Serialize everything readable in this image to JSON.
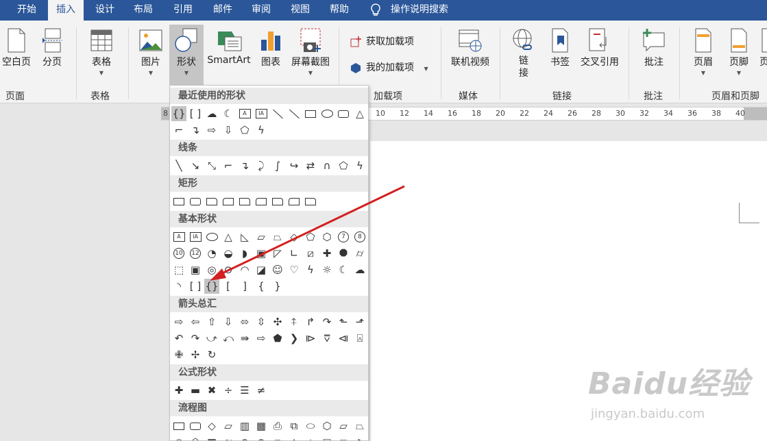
{
  "tabs": {
    "t1": "开始",
    "t2": "插入",
    "t3": "设计",
    "t4": "布局",
    "t5": "引用",
    "t6": "邮件",
    "t7": "审阅",
    "t8": "视图",
    "t9": "帮助",
    "search": "操作说明搜索"
  },
  "ribbon": {
    "blank_page": "空白页",
    "page_break": "分页",
    "table": "表格",
    "pictures": "图片",
    "shapes": "形状",
    "smartart": "SmartArt",
    "chart": "图表",
    "screenshot": "屏幕截图",
    "get_addins": "获取加载项",
    "my_addins": "我的加载项",
    "online_video": "联机视频",
    "link": "链\n接",
    "bookmark": "书签",
    "cross_ref": "交叉引用",
    "comment": "批注",
    "header": "页眉",
    "footer": "页脚",
    "page_num_partial": "页"
  },
  "groups": {
    "pages": "页面",
    "tables": "表格",
    "addins": "加载项",
    "media": "媒体",
    "links": "链接",
    "comments": "批注",
    "header_footer": "页眉和页脚"
  },
  "ruler": [
    "8",
    "10",
    "12",
    "14",
    "16",
    "18",
    "20",
    "22",
    "24",
    "26",
    "28",
    "30",
    "32",
    "34",
    "36",
    "38",
    "40"
  ],
  "gallery": {
    "recent": "最近使用的形状",
    "lines": "线条",
    "rectangles": "矩形",
    "basic": "基本形状",
    "block_arrows": "箭头总汇",
    "equation": "公式形状",
    "flowchart": "流程图"
  },
  "basic_numbers": {
    "n7": "7",
    "n8": "8",
    "n10": "10",
    "n12": "12"
  },
  "icons": {
    "recent_row1": [
      "double-brace-icon",
      "bracket-pair-icon",
      "cloud-icon",
      "moon-icon",
      "text-box-icon",
      "vertical-text-box-icon",
      "line-icon",
      "arrow-line-icon",
      "rectangle-icon",
      "oval-icon",
      "rounded-rectangle-icon",
      "triangle-icon"
    ],
    "recent_row2": [
      "elbow-connector-icon",
      "elbow-arrow-connector-icon",
      "right-arrow-icon",
      "down-arrow-icon",
      "snip-corner-icon",
      "freeform-icon"
    ]
  },
  "watermark": {
    "brand": "Baidu经验",
    "url": "jingyan.baidu.com"
  },
  "colors": {
    "tab_bar": "#2b579a",
    "ribbon_bg": "#f3f3f3",
    "arrow": "#d32020"
  }
}
